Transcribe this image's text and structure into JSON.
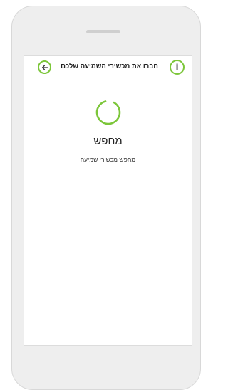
{
  "header": {
    "title": "חברו את מכשירי השמיעה שלכם",
    "back_icon": "arrow-left-icon",
    "info_icon": "info-icon",
    "info_glyph": "i"
  },
  "main": {
    "status_title": "מחפש",
    "status_subtitle": "מחפש מכשירי שמיעה"
  },
  "colors": {
    "accent": "#7cc63a",
    "text": "#222222"
  }
}
